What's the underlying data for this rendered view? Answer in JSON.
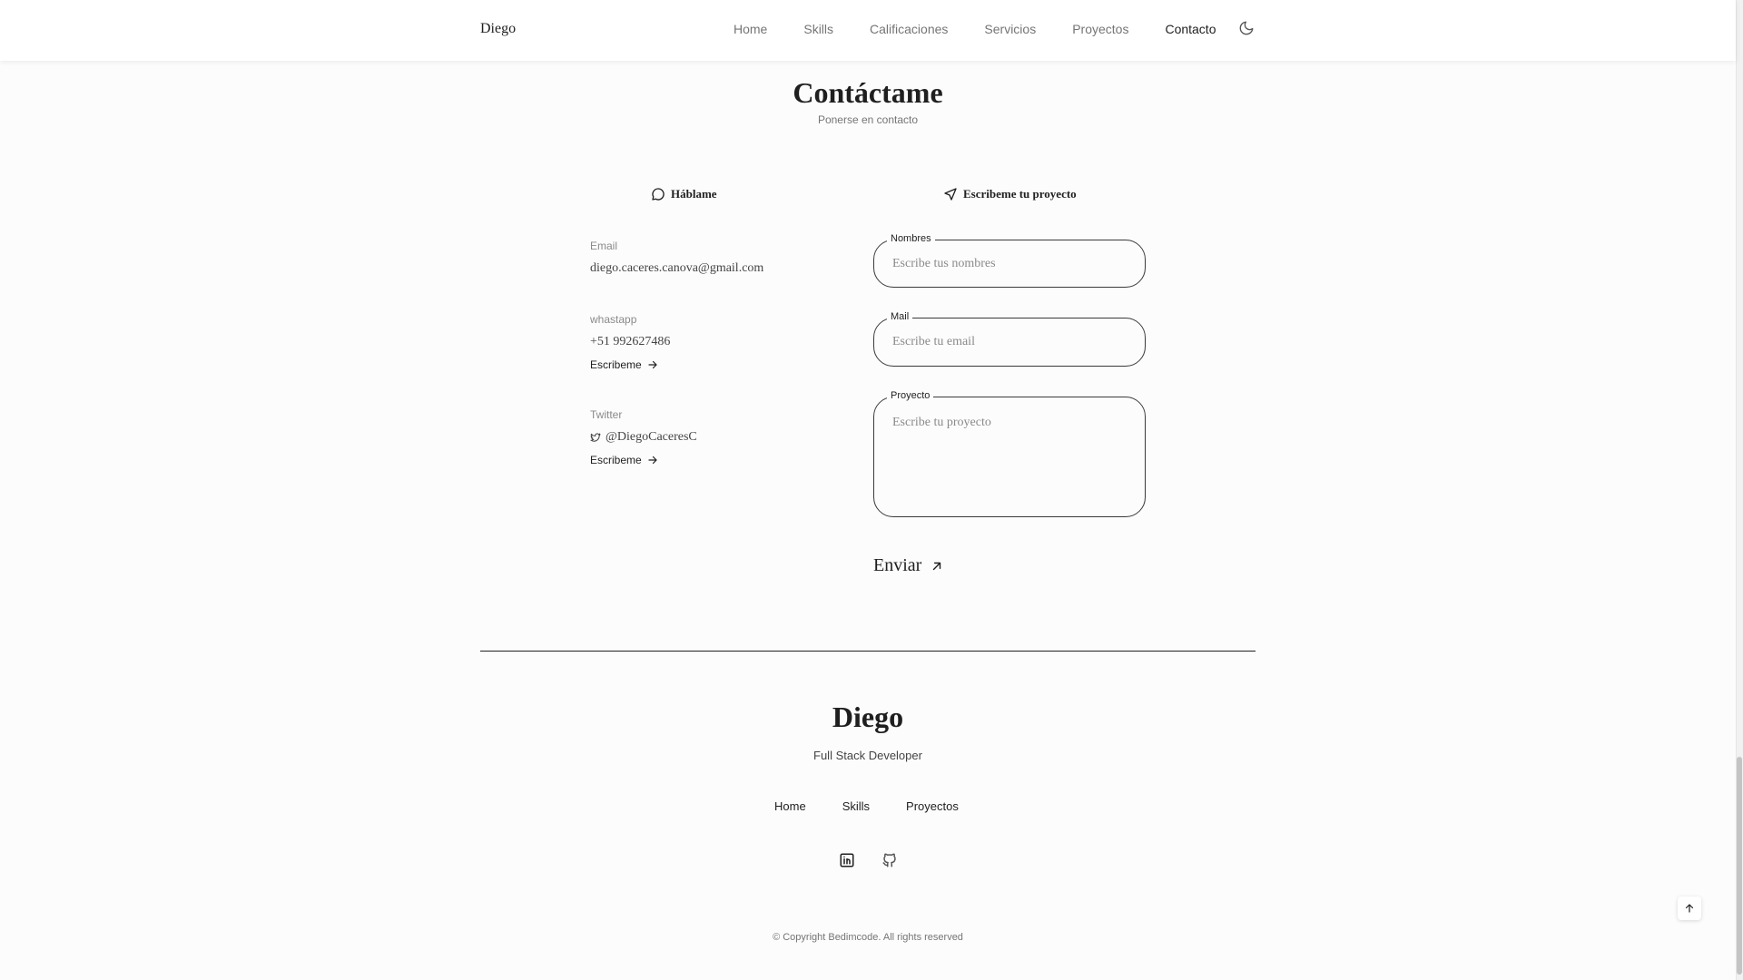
{
  "header": {
    "brand": "Diego",
    "nav": [
      "Home",
      "Skills",
      "Calificaciones",
      "Servicios",
      "Proyectos",
      "Contacto"
    ],
    "active": "Contacto",
    "theme_icon": "moon-icon"
  },
  "contact": {
    "title": "Contáctame",
    "subtitle": "Ponerse en contacto",
    "talk_title": "Háblame",
    "write_title": "Escribeme tu proyecto",
    "cards": [
      {
        "label": "Email",
        "value": "diego.caceres.canova@gmail.com"
      },
      {
        "label": "whastapp",
        "value": "+51 992627486",
        "link": "Escribeme"
      },
      {
        "label": "Twitter",
        "value": "@DiegoCaceresC",
        "link": "Escribeme"
      }
    ],
    "form": {
      "name_label": "Nombres",
      "name_placeholder": "Escribe tus nombres",
      "mail_label": "Mail",
      "mail_placeholder": "Escribe tu email",
      "project_label": "Proyecto",
      "project_placeholder": "Escribe tu proyecto",
      "submit": "Enviar"
    }
  },
  "footer": {
    "title": "Diego",
    "subtitle": "Full Stack Developer",
    "nav": [
      "Home",
      "Skills",
      "Proyectos"
    ],
    "social": [
      "linkedin-icon",
      "github-icon"
    ],
    "copyright": "© Copyright Bedimcode. All rights reserved"
  }
}
